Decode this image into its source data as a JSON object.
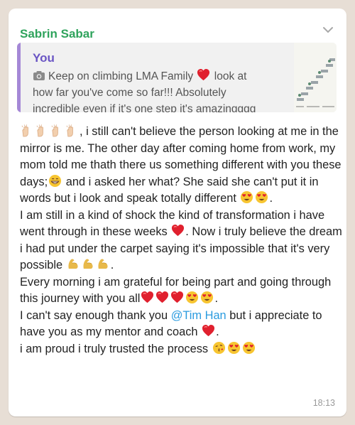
{
  "message": {
    "sender": "Sabrin Sabar",
    "time": "18:13",
    "quote": {
      "author": "You",
      "text": "Keep on climbing LMA Family",
      "text_after_heart": " look at how far you've come so far!!! Absolutely incredible even if it's one step it's amazingggg"
    },
    "body": {
      "p1_a": ", i still can't believe the person looking at me in the mirror is me. The other day after coming home from work,  my mom told me thath there us something different with you these days;",
      "p1_b": "  and i asked her what? She said she can't put it in words but i look and speak totally different ",
      "p1_c": ".",
      "p2_a": "I am still in a kind of shock the kind of transformation i have went through in these weeks ",
      "p2_b": ". Now i truly believe the dream i had put under the carpet saying it's impossible that it's very possible ",
      "p2_c": ".",
      "p3_a": "Every morning i am grateful for being part and going through this journey with you all",
      "p3_b": ".",
      "p4_a": "I can't say enough thank you ",
      "mention": "@Tim Han",
      "p4_b": "  but i appreciate to have you as my mentor and coach ",
      "p4_c": ".",
      "p5_a": "i am proud i truly trusted the process "
    }
  },
  "colors": {
    "sender": "#2fa35c",
    "quote_author": "#6a55c4",
    "quote_bar": "#a588d6",
    "mention": "#2a9bdf",
    "heart": "#e0202e",
    "emoji_face": "#f7c531"
  },
  "icons": [
    "chevron-down-icon",
    "camera-icon",
    "red-heart-icon",
    "clapping-hands-icon",
    "grinning-face-icon",
    "heart-eyes-face-icon",
    "flexed-biceps-icon",
    "kissing-face-icon"
  ]
}
